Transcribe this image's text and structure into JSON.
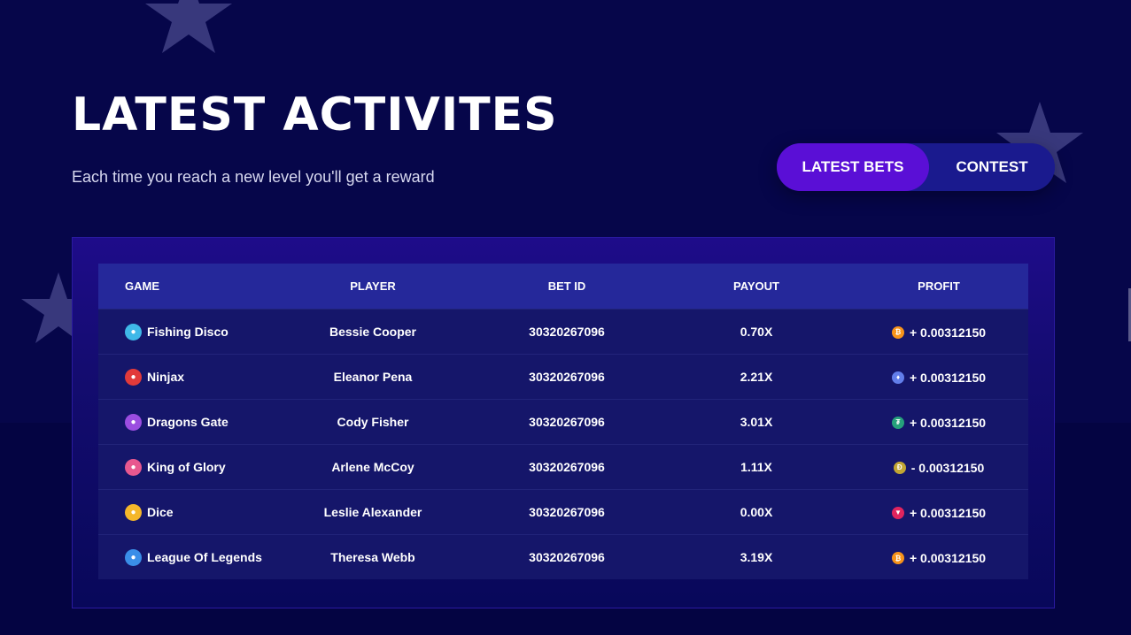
{
  "header": {
    "title": "LATEST ACTIVITES",
    "subtitle": "Each time you reach a new level you'll get a reward"
  },
  "tabs": [
    {
      "label": "LATEST BETS",
      "active": true
    },
    {
      "label": "CONTEST",
      "active": false
    }
  ],
  "table": {
    "columns": [
      "GAME",
      "PLAYER",
      "BET ID",
      "PAYOUT",
      "PROFIT"
    ],
    "rows": [
      {
        "game": "Fishing Disco",
        "game_icon": "fishing-disco-icon",
        "icon_color": "#3fb8e8",
        "player": "Bessie Cooper",
        "bet_id": "30320267096",
        "payout": "0.70X",
        "profit": "+ 0.00312150",
        "coin": "bitcoin-icon",
        "coin_color": "#f7931a",
        "coin_glyph": "₿"
      },
      {
        "game": "Ninjax",
        "game_icon": "ninjax-icon",
        "icon_color": "#e23a3a",
        "player": "Eleanor Pena",
        "bet_id": "30320267096",
        "payout": "2.21X",
        "profit": "+ 0.00312150",
        "coin": "ethereum-icon",
        "coin_color": "#627eea",
        "coin_glyph": "♦"
      },
      {
        "game": "Dragons Gate",
        "game_icon": "dragons-gate-icon",
        "icon_color": "#9b4de0",
        "player": "Cody Fisher",
        "bet_id": "30320267096",
        "payout": "3.01X",
        "profit": "+ 0.00312150",
        "coin": "tether-icon",
        "coin_color": "#26a17b",
        "coin_glyph": "₮"
      },
      {
        "game": "King of Glory",
        "game_icon": "king-of-glory-icon",
        "icon_color": "#e8588f",
        "player": "Arlene McCoy",
        "bet_id": "30320267096",
        "payout": "1.11X",
        "profit": "- 0.00312150",
        "coin": "dogecoin-icon",
        "coin_color": "#c2a633",
        "coin_glyph": "Ð"
      },
      {
        "game": "Dice",
        "game_icon": "dice-icon",
        "icon_color": "#f5b72a",
        "player": "Leslie Alexander",
        "bet_id": "30320267096",
        "payout": "0.00X",
        "profit": "+ 0.00312150",
        "coin": "tron-icon",
        "coin_color": "#e0245e",
        "coin_glyph": "▼"
      },
      {
        "game": "League Of Legends",
        "game_icon": "league-of-legends-icon",
        "icon_color": "#3a8ee8",
        "player": "Theresa Webb",
        "bet_id": "30320267096",
        "payout": "3.19X",
        "profit": "+ 0.00312150",
        "coin": "bitcoin-icon",
        "coin_color": "#f7931a",
        "coin_glyph": "₿"
      }
    ]
  },
  "colors": {
    "background": "#06064a",
    "active_tab": "#5a0fd6",
    "tab_track": "#1a1a8e",
    "table_header": "#25289a",
    "table_row": "#15166a"
  }
}
